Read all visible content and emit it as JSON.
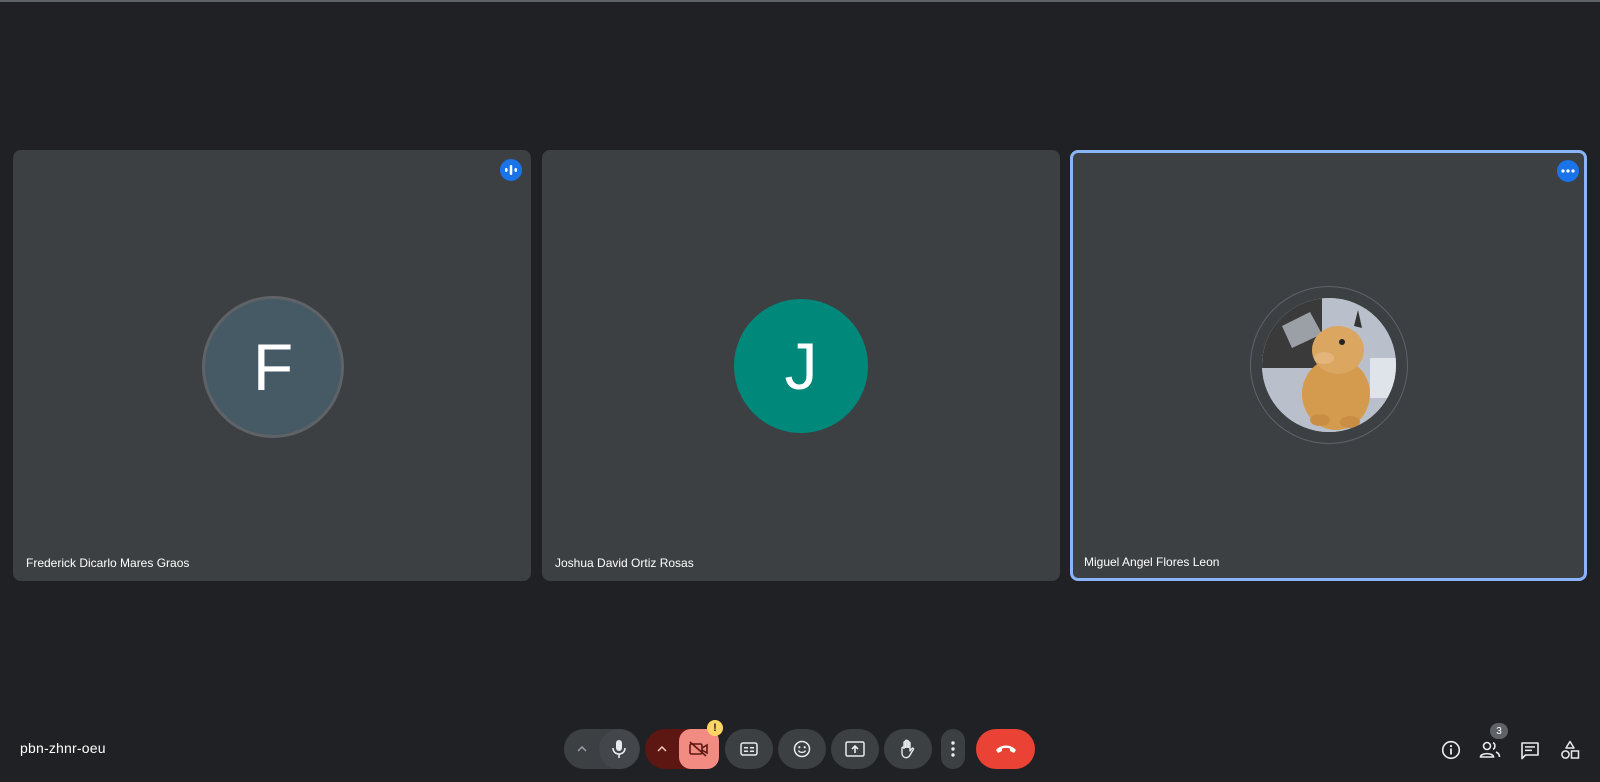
{
  "meeting": {
    "code": "pbn-zhnr-oeu"
  },
  "participants": [
    {
      "name": "Frederick Dicarlo Mares Graos",
      "initial": "F",
      "avatar_color": "#455a64",
      "indicator": "speaking-icon"
    },
    {
      "name": "Joshua David Ortiz Rosas",
      "initial": "J",
      "avatar_color": "#00897b"
    },
    {
      "name": "Miguel Angel Flores Leon",
      "avatar": "photo",
      "indicator": "more-options-icon",
      "highlighted": true
    }
  ],
  "controls": {
    "camera_warning": "!",
    "items": [
      "audio-options",
      "microphone",
      "video-options",
      "camera-off",
      "captions",
      "reactions",
      "present-screen",
      "raise-hand",
      "more-options",
      "leave-call"
    ]
  },
  "side_panel": {
    "people_count": "3",
    "items": [
      "meeting-details",
      "people",
      "chat",
      "activities"
    ]
  },
  "colors": {
    "background": "#202124",
    "tile": "#3c4043",
    "accent": "#1a73e8",
    "active_border": "#8ab4f8",
    "end_call": "#ea4335",
    "camera_off": "#f28b82"
  }
}
